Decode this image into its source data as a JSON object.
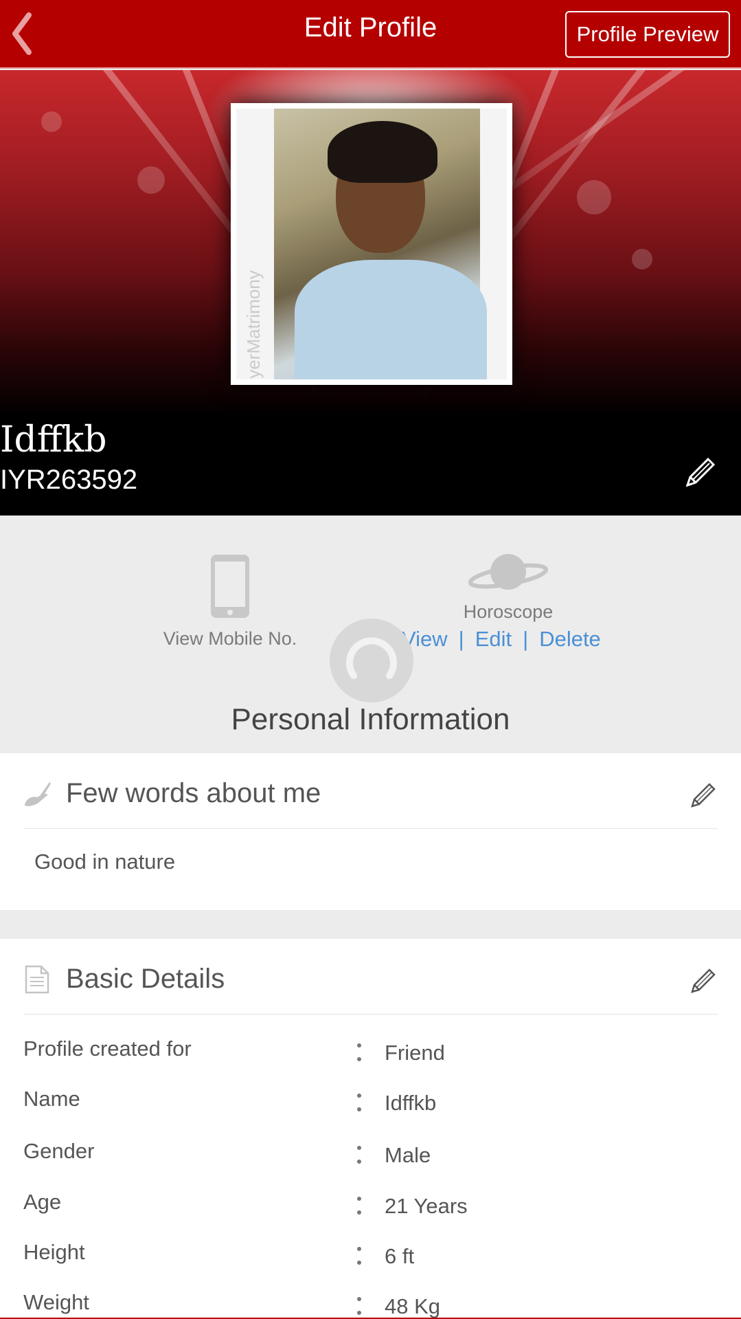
{
  "header": {
    "title": "Edit Profile",
    "preview_label": "Profile Preview"
  },
  "profile": {
    "name": "Idffkb",
    "id": "IYR263592",
    "photo_watermark": "IyerMatrimony"
  },
  "quick_actions": {
    "mobile_label": "View Mobile No.",
    "horoscope_label": "Horoscope",
    "horoscope_links": {
      "view": "View",
      "edit": "Edit",
      "delete": "Delete",
      "separator": "|"
    }
  },
  "section_title": "Personal Information",
  "about": {
    "title": "Few words about me",
    "text": "Good in nature"
  },
  "basic_details": {
    "title": "Basic Details",
    "rows": [
      {
        "label": "Profile created for",
        "value": "Friend"
      },
      {
        "label": "Name",
        "value": "Idffkb"
      },
      {
        "label": "Gender",
        "value": "Male"
      },
      {
        "label": "Age",
        "value": "21 Years"
      },
      {
        "label": "Height",
        "value": "6 ft"
      },
      {
        "label": "Weight",
        "value": "48 Kg"
      }
    ]
  },
  "colors": {
    "brand_red": "#b50000",
    "link_blue": "#4a90d6"
  }
}
